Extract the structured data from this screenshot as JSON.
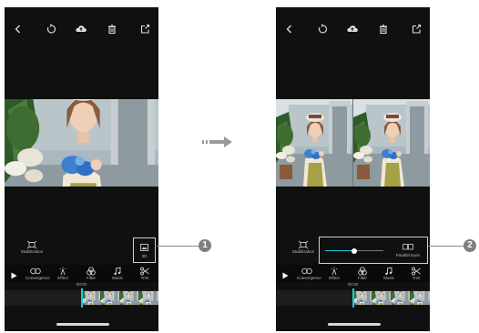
{
  "colors": {
    "accent": "#1ec8d8",
    "screen_bg": "#101010",
    "callout": "#7f7f7f",
    "arrow": "#9a9a9a"
  },
  "icons": {
    "top_toolbar": [
      "back-icon",
      "undo-icon",
      "cloud-upload-icon",
      "delete-icon",
      "share-icon"
    ],
    "tabs": [
      "convergence-icon",
      "effect-icon",
      "filter-icon",
      "music-icon",
      "trim-icon"
    ],
    "other": [
      "play-icon",
      "stabilization-icon",
      "3d-icon",
      "parallel-eyes-icon",
      "arrow-right-icon"
    ]
  },
  "editor_left": {
    "stabilization_label": "Stabilization",
    "mode_button_label": "3D",
    "tabs": [
      {
        "label": "Convergence"
      },
      {
        "label": "Effect"
      },
      {
        "label": "Filter"
      },
      {
        "label": "Music"
      },
      {
        "label": "Trim"
      }
    ],
    "timecode": "00:00",
    "callout_number": "1"
  },
  "editor_right": {
    "stabilization_label": "Stabilization",
    "parallel_eyes_label": "Parallel Eyes",
    "slider_level": 0.5,
    "tabs": [
      {
        "label": "Convergence"
      },
      {
        "label": "Effect"
      },
      {
        "label": "Filter"
      },
      {
        "label": "Music"
      },
      {
        "label": "Trim"
      }
    ],
    "timecode": "00:00",
    "callout_number": "2"
  }
}
